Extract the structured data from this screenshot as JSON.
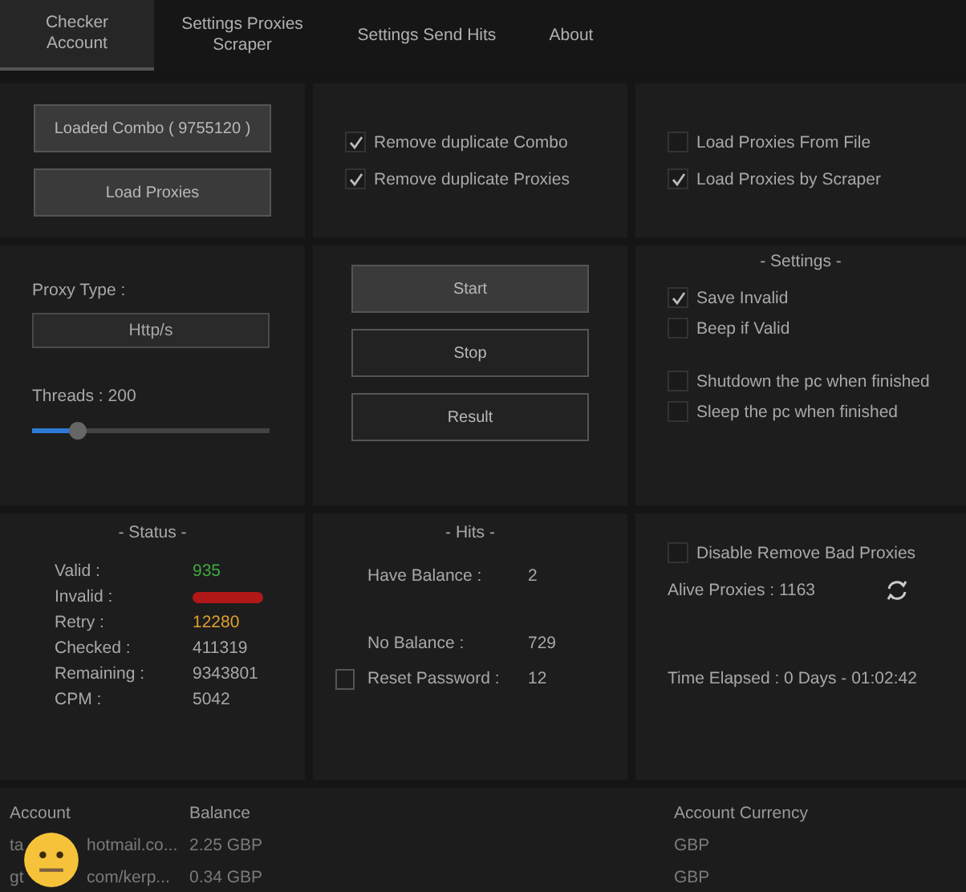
{
  "tabs": [
    {
      "label": "Checker Account",
      "selected": true
    },
    {
      "label": "Settings Proxies Scraper",
      "selected": false
    },
    {
      "label": "Settings Send Hits",
      "selected": false
    },
    {
      "label": "About",
      "selected": false
    }
  ],
  "load_buttons": [
    "Loaded Combo ( 9755120 )",
    "Load Proxies"
  ],
  "duplicate_options": [
    {
      "label": "Remove duplicate Combo",
      "checked": true
    },
    {
      "label": "Remove duplicate Proxies",
      "checked": true
    }
  ],
  "proxy_source_options": [
    {
      "label": "Load Proxies From File",
      "checked": false
    },
    {
      "label": "Load Proxies by Scraper",
      "checked": true
    }
  ],
  "proxy_type": {
    "label": "Proxy Type :",
    "value": "Http/s"
  },
  "threads": {
    "label": "Threads : 200",
    "level": 0.17
  },
  "actions": [
    {
      "label": "Start",
      "hovered": true
    },
    {
      "label": "Stop",
      "hovered": false
    },
    {
      "label": "Result",
      "hovered": false
    }
  ],
  "settings": {
    "title": "-  Settings  -",
    "options": [
      {
        "label": "Save Invalid",
        "checked": true
      },
      {
        "label": "Beep if Valid",
        "checked": false
      },
      {
        "label": "Shutdown the pc when finished",
        "checked": false
      },
      {
        "label": "Sleep the pc when finished",
        "checked": false
      }
    ]
  },
  "status": {
    "title": "-  Status  -",
    "rows": [
      {
        "label": "Valid :",
        "value": "935",
        "color": "#3fa843"
      },
      {
        "label": "Invalid :",
        "kind": "blurred",
        "color": "#b01818"
      },
      {
        "label": "Retry :",
        "value": "12280",
        "color": "#e0a030"
      },
      {
        "label": "Checked :",
        "value": "411319",
        "color": "#a8a8a8"
      },
      {
        "label": "Remaining :",
        "value": "9343801",
        "color": "#a8a8a8"
      },
      {
        "label": "CPM :",
        "value": "5042",
        "color": "#a8a8a8"
      }
    ]
  },
  "hits": {
    "title": "-  Hits  -",
    "rows": [
      {
        "label": "Have Balance :",
        "value": "2",
        "kind": "plain"
      },
      {
        "label": "No Balance :",
        "value": "729",
        "kind": "plain"
      },
      {
        "label": "Reset Password :",
        "value": "12",
        "kind": "flagged"
      }
    ]
  },
  "proxies": {
    "option": {
      "label": "Disable Remove Bad Proxies",
      "checked": false
    },
    "alive": "Alive Proxies : 1163"
  },
  "time_elapsed": "Time Elapsed : 0 Days - 01:02:42",
  "table": {
    "columns": [
      "Account",
      "Balance",
      "Account Currency"
    ],
    "rows": [
      {
        "account_start": "ta",
        "account_end": "hotmail.co...",
        "balance": "2.25 GBP",
        "currency": "GBP"
      },
      {
        "account_start": "gt",
        "account_end": "com/kerp...",
        "balance": "0.34 GBP",
        "currency": "GBP"
      }
    ]
  }
}
